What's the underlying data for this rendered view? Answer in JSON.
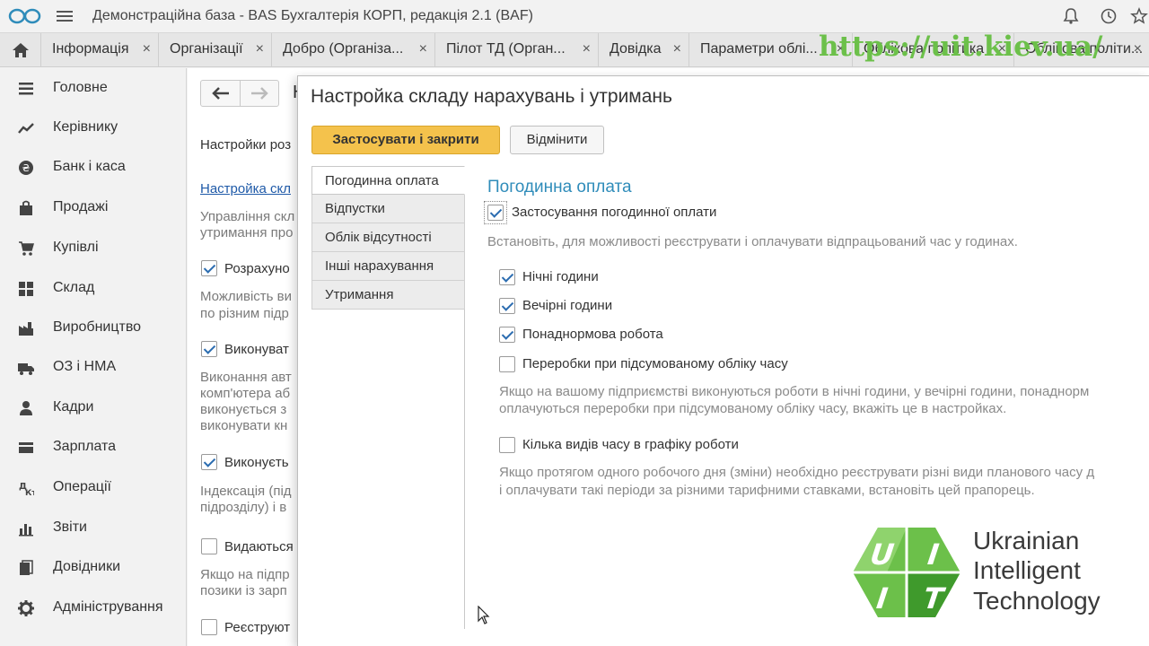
{
  "app": {
    "title": "Демонстраційна база - BAS Бухгалтерія КОРП, редакція 2.1  (BAF)"
  },
  "icons": {
    "logo": "1c-logo-icon",
    "menu": "hamburger-menu-icon",
    "bell": "bell-icon",
    "history": "history-icon",
    "star": "star-icon",
    "home": "home-icon"
  },
  "tabs": [
    {
      "label": "Інформація",
      "close": "×"
    },
    {
      "label": "Організації",
      "close": "×"
    },
    {
      "label": "Добро (Організа...",
      "close": "×"
    },
    {
      "label": "Пілот ТД (Орган...",
      "close": "×"
    },
    {
      "label": "Довідка",
      "close": "×"
    },
    {
      "label": "Параметри облі...",
      "close": "×"
    },
    {
      "label": "Облікова політика",
      "close": "×"
    },
    {
      "label": "Облікова політи...",
      "close": "×"
    }
  ],
  "watermark_url": "https://uit.kiev.ua/",
  "sidebar": {
    "items": [
      {
        "label": "Головне",
        "icon": "list-icon"
      },
      {
        "label": "Керівнику",
        "icon": "trend-icon"
      },
      {
        "label": "Банк і каса",
        "icon": "coin-icon"
      },
      {
        "label": "Продажі",
        "icon": "bag-icon"
      },
      {
        "label": "Купівлі",
        "icon": "cart-icon"
      },
      {
        "label": "Склад",
        "icon": "warehouse-icon"
      },
      {
        "label": "Виробництво",
        "icon": "factory-icon"
      },
      {
        "label": "ОЗ і НМА",
        "icon": "truck-icon"
      },
      {
        "label": "Кадри",
        "icon": "person-icon"
      },
      {
        "label": "Зарплата",
        "icon": "card-icon"
      },
      {
        "label": "Операції",
        "icon": "operations-icon"
      },
      {
        "label": "Звіти",
        "icon": "bar-chart-icon"
      },
      {
        "label": "Довідники",
        "icon": "books-icon"
      },
      {
        "label": "Адміністрування",
        "icon": "gear-icon"
      }
    ]
  },
  "background_form": {
    "title_partial": "Н",
    "settings_label": "Настройки роз",
    "link": "Настройка скл",
    "desc1_line1": "Управління скл",
    "desc1_line2": "утримання про",
    "cb1_label": "Розрахуно",
    "desc2_line1": "Можливість ви",
    "desc2_line2": "по різним підр",
    "cb2_label": "Виконуват",
    "desc3_line1": "Виконання авт",
    "desc3_line2": "комп'ютера аб",
    "desc3_line3": "виконується з",
    "desc3_line4": "виконувати кн",
    "cb3_label": "Виконуєть",
    "desc4_line1": "Індексація (під",
    "desc4_line2": "підрозділу) і в",
    "cb4_label": "Видаються",
    "desc5_line1": "Якщо на підпр",
    "desc5_line2": "позики із зарп",
    "cb5_label": "Реєструют"
  },
  "dialog": {
    "title": "Настройка складу нарахувань і утримань",
    "apply_close": "Застосувати і закрити",
    "cancel": "Відмінити",
    "vtabs": [
      "Погодинна оплата",
      "Відпустки",
      "Облік відсутності",
      "Інші нарахування",
      "Утримання"
    ],
    "panel": {
      "title": "Погодинна оплата",
      "main_checkbox": "Застосування погодинної оплати",
      "main_desc": "Встановіть, для можливості реєструвати і оплачувати відпрацьований час у годинах.",
      "night": "Нічні години",
      "evening": "Вечірні години",
      "overtime": "Понаднормова робота",
      "rework": "Переробки при підсумованому обліку часу",
      "hint1_line1": "Якщо на вашому підприємстві виконуються роботи в нічні години, у вечірні години, понаднорм",
      "hint1_line2": "оплачуються переробки при підсумованому обліку часу, вкажіть це в настройках.",
      "multi_time": "Кілька видів часу в графіку роботи",
      "hint2_line1": "Якщо протягом одного робочого дня (зміни) необхідно реєструвати різні види планового часу д",
      "hint2_line2": "і оплачувати такі періоди за різними тарифними ставками, встановіть цей прапорець."
    }
  },
  "company_logo": {
    "mark_text": "UIT",
    "line1": "Ukrainian",
    "line2": "Intelligent",
    "line3": "Technology"
  }
}
